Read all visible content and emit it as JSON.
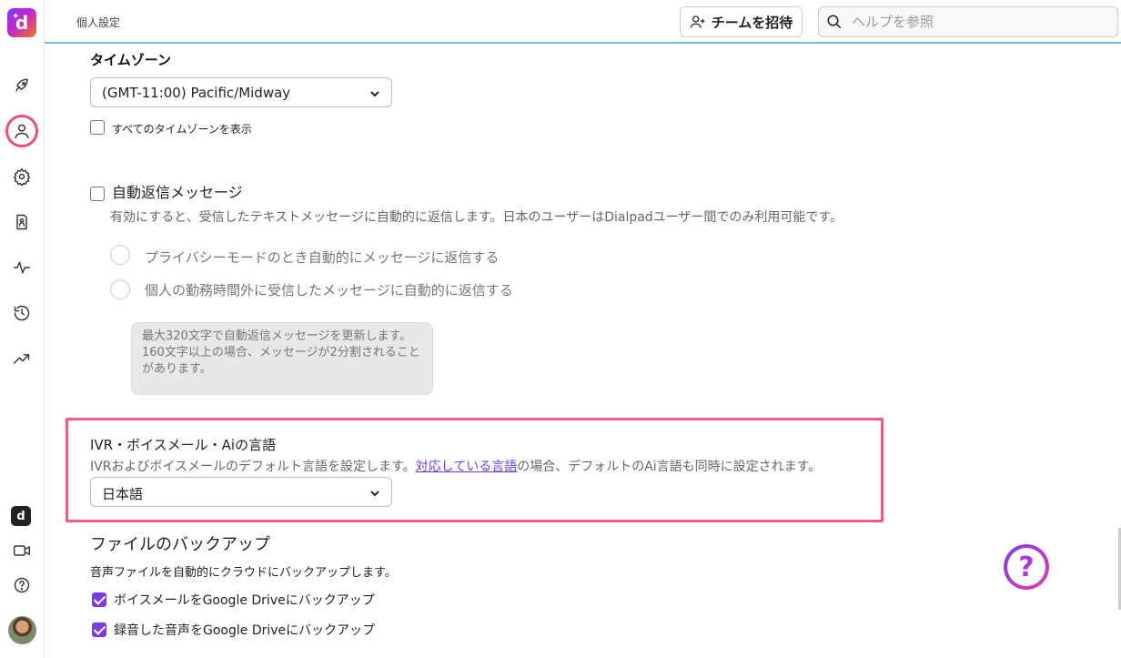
{
  "app": {
    "logo_text": "d"
  },
  "topbar": {
    "breadcrumb": "個人設定",
    "invite_label": "チームを招待",
    "help_placeholder": "ヘルプを参照"
  },
  "sidebar": {
    "items": [
      {
        "name": "rocket-icon"
      },
      {
        "name": "person-icon",
        "active": true
      },
      {
        "name": "gear-icon"
      },
      {
        "name": "contacts-icon"
      },
      {
        "name": "activity-icon"
      },
      {
        "name": "history-icon"
      },
      {
        "name": "trending-icon"
      }
    ],
    "bottom": [
      "ai-badge-icon",
      "video-icon",
      "help-icon",
      "user-avatar"
    ]
  },
  "timezone": {
    "heading": "タイムゾーン",
    "selected": "(GMT-11:00) Pacific/Midway",
    "show_all_label": "すべてのタイムゾーンを表示"
  },
  "auto_reply": {
    "title": "自動返信メッセージ",
    "description": "有効にすると、受信したテキストメッセージに自動的に返信します。日本のユーザーはDialpadユーザー間でのみ利用可能です。",
    "options": [
      "プライバシーモードのとき自動的にメッセージに返信する",
      "個人の勤務時間外に受信したメッセージに自動的に返信する"
    ],
    "message_placeholder": "最大320文字で自動返信メッセージを更新します。160文字以上の場合、メッセージが2分割されることがあります。"
  },
  "language": {
    "title": "IVR・ボイスメール・Aiの言語",
    "desc_before": "IVRおよびボイスメールのデフォルト言語を設定します。",
    "desc_link": "対応している言語",
    "desc_after": "の場合、デフォルトのAi言語も同時に設定されます。",
    "selected": "日本語"
  },
  "backup": {
    "title": "ファイルのバックアップ",
    "description": "音声ファイルを自動的にクラウドにバックアップします。",
    "options": [
      {
        "label": "ボイスメールをGoogle Driveにバックアップ",
        "checked": true
      },
      {
        "label": "録音した音声をGoogle Driveにバックアップ",
        "checked": true
      }
    ]
  },
  "help_fab": "?",
  "colors": {
    "accent": "#7c3aed",
    "highlight": "#ec5a8c",
    "topbar_border": "#74b8e0"
  }
}
